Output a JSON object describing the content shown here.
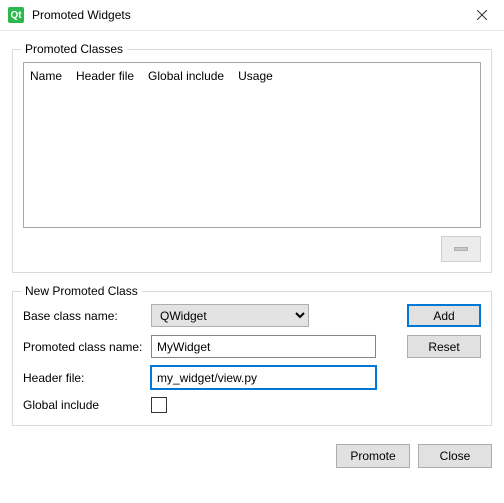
{
  "window": {
    "icon_letters": "Qt",
    "title": "Promoted Widgets"
  },
  "promoted_classes": {
    "legend": "Promoted Classes",
    "columns": [
      "Name",
      "Header file",
      "Global include",
      "Usage"
    ],
    "rows": []
  },
  "new_promoted_class": {
    "legend": "New Promoted Class",
    "base_label": "Base class name:",
    "base_value": "QWidget",
    "promoted_label": "Promoted class name:",
    "promoted_value": "MyWidget",
    "header_label": "Header file:",
    "header_value": "my_widget/view.py",
    "global_label": "Global include",
    "global_checked": false,
    "add_label": "Add",
    "reset_label": "Reset"
  },
  "footer": {
    "promote_label": "Promote",
    "close_label": "Close"
  }
}
